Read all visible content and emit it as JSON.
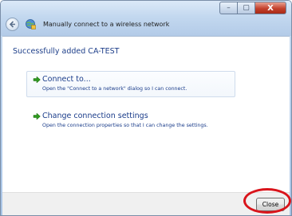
{
  "window": {
    "title": "Manually connect to a wireless network",
    "controls": {
      "minimize_glyph": "–",
      "maximize_glyph": "▢",
      "close_glyph": "X"
    },
    "back_icon": "back-arrow-icon",
    "app_icon": "wireless-network-icon"
  },
  "main": {
    "heading": "Successfully added CA-TEST",
    "options": [
      {
        "title": "Connect to...",
        "description": "Open the \"Connect to a network\" dialog so I can connect.",
        "icon": "green-arrow-icon"
      },
      {
        "title": "Change connection settings",
        "description": "Open the connection properties so that I can change the settings.",
        "icon": "green-arrow-icon"
      }
    ]
  },
  "footer": {
    "close_label": "Close"
  },
  "colors": {
    "link_blue": "#1a3c8a",
    "arrow_green": "#2f9a1f",
    "highlight_red": "#d9141b"
  }
}
